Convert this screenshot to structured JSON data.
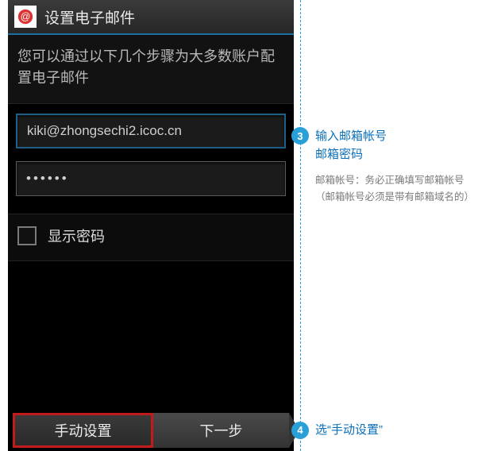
{
  "titlebar": {
    "title": "设置电子邮件"
  },
  "subhead": "您可以通过以下几个步骤为大多数账户配置电子邮件",
  "email_field": {
    "value": "kiki@zhongsechi2.icoc.cn"
  },
  "password_field": {
    "value": "••••••"
  },
  "show_password": {
    "label": "显示密码"
  },
  "buttons": {
    "manual": "手动设置",
    "next": "下一步"
  },
  "annotations": {
    "step3": {
      "num": "3",
      "line1": "输入邮箱帐号",
      "line2": "邮箱密码",
      "note1": "邮箱帐号：务必正确填写邮箱帐号",
      "note2": "（邮箱帐号必须是带有邮箱域名的）"
    },
    "step4": {
      "num": "4",
      "text": "选“手动设置”"
    }
  }
}
